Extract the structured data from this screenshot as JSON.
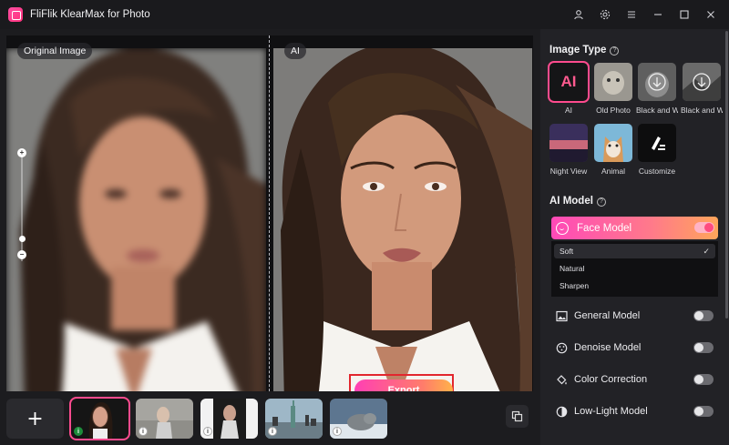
{
  "app": {
    "title": "FliFlik KlearMax for Photo"
  },
  "titlebar": {
    "icons": [
      "user-icon",
      "gear-icon",
      "menu-icon",
      "minimize-icon",
      "maximize-icon",
      "close-icon"
    ]
  },
  "preview": {
    "original_label": "Original Image",
    "ai_label": "AI",
    "zoom_in": "+",
    "zoom_out": "−"
  },
  "export_label": "Export",
  "thumbnails": [
    {
      "name": "portrait-woman",
      "active": true,
      "status": "ok"
    },
    {
      "name": "woman-outdoors",
      "active": false,
      "status": "info"
    },
    {
      "name": "woman-dark",
      "active": false,
      "status": "info"
    },
    {
      "name": "statue-of-liberty",
      "active": false,
      "status": "info"
    },
    {
      "name": "seal",
      "active": false,
      "status": "info"
    }
  ],
  "add_label": "+",
  "sidebar": {
    "image_type_title": "Image Type",
    "ai_tile_text": "AI",
    "types": [
      {
        "label": "AI",
        "selected": true
      },
      {
        "label": "Old Photo",
        "selected": false
      },
      {
        "label": "Black and White",
        "selected": false
      },
      {
        "label": "Black and White",
        "selected": false
      },
      {
        "label": "Night View",
        "selected": false
      },
      {
        "label": "Animal",
        "selected": false
      },
      {
        "label": "Customize",
        "selected": false
      }
    ],
    "ai_model_title": "AI Model",
    "face_model": {
      "label": "Face Model",
      "enabled": true
    },
    "face_options": [
      "Soft",
      "Natural",
      "Sharpen"
    ],
    "face_selected": "Soft",
    "check_mark": "✓",
    "models": [
      {
        "label": "General Model",
        "icon": "image-icon",
        "enabled": false
      },
      {
        "label": "Denoise Model",
        "icon": "denoise-icon",
        "enabled": false
      },
      {
        "label": "Color Correction",
        "icon": "paint-bucket-icon",
        "enabled": false
      },
      {
        "label": "Low-Light Model",
        "icon": "contrast-icon",
        "enabled": false
      }
    ]
  },
  "colors": {
    "accent": "#ff4b8e",
    "export_frame": "#e2262e",
    "sidebar_bg": "#222226",
    "work_bg": "#1c1c1f"
  }
}
